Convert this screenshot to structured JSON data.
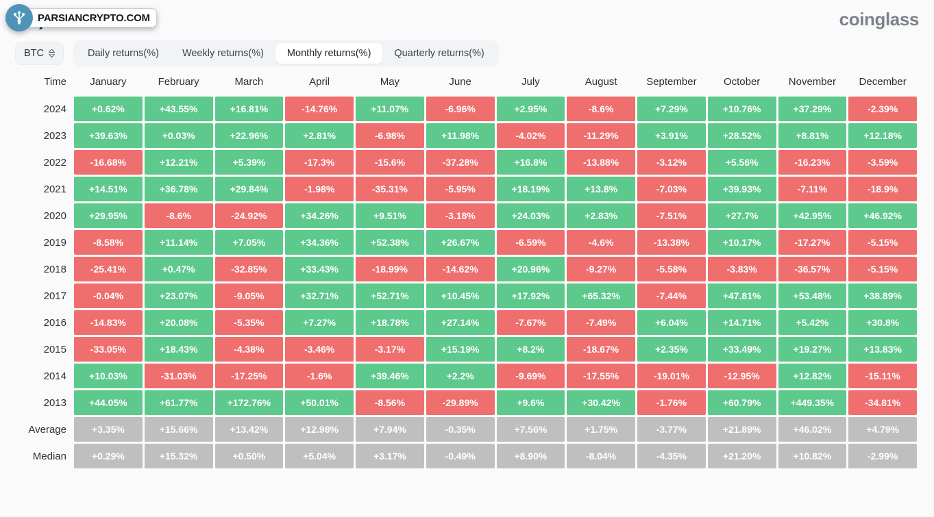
{
  "header": {
    "title": "(%)",
    "brand": "coinglass"
  },
  "watermark": {
    "text": "PARSIANCRYPTO.COM",
    "badge_icon": "tree-icon",
    "badge_color": "#4f93b8"
  },
  "controls": {
    "symbol": "BTC",
    "stepper_icon": "chevron-up-down-icon",
    "tabs": [
      {
        "label": "Daily returns(%)",
        "active": false
      },
      {
        "label": "Weekly returns(%)",
        "active": false
      },
      {
        "label": "Monthly returns(%)",
        "active": true
      },
      {
        "label": "Quarterly returns(%)",
        "active": false
      }
    ]
  },
  "colors": {
    "positive": "#5dc98c",
    "negative": "#ef6e6e",
    "neutral": "#bfbfbf",
    "page_bg": "#fafafa"
  },
  "chart_data": {
    "type": "heatmap",
    "title": "(%)",
    "xlabel": "",
    "ylabel": "Time",
    "columns": [
      "Time",
      "January",
      "February",
      "March",
      "April",
      "May",
      "June",
      "July",
      "August",
      "September",
      "October",
      "November",
      "December"
    ],
    "categories": [
      "January",
      "February",
      "March",
      "April",
      "May",
      "June",
      "July",
      "August",
      "September",
      "October",
      "November",
      "December"
    ],
    "rows": [
      {
        "label": "2024",
        "kind": "year",
        "values": [
          "+0.62%",
          "+43.55%",
          "+16.81%",
          "-14.76%",
          "+11.07%",
          "-6.96%",
          "+2.95%",
          "-8.6%",
          "+7.29%",
          "+10.76%",
          "+37.29%",
          "-2.39%"
        ]
      },
      {
        "label": "2023",
        "kind": "year",
        "values": [
          "+39.63%",
          "+0.03%",
          "+22.96%",
          "+2.81%",
          "-6.98%",
          "+11.98%",
          "-4.02%",
          "-11.29%",
          "+3.91%",
          "+28.52%",
          "+8.81%",
          "+12.18%"
        ]
      },
      {
        "label": "2022",
        "kind": "year",
        "values": [
          "-16.68%",
          "+12.21%",
          "+5.39%",
          "-17.3%",
          "-15.6%",
          "-37.28%",
          "+16.8%",
          "-13.88%",
          "-3.12%",
          "+5.56%",
          "-16.23%",
          "-3.59%"
        ]
      },
      {
        "label": "2021",
        "kind": "year",
        "values": [
          "+14.51%",
          "+36.78%",
          "+29.84%",
          "-1.98%",
          "-35.31%",
          "-5.95%",
          "+18.19%",
          "+13.8%",
          "-7.03%",
          "+39.93%",
          "-7.11%",
          "-18.9%"
        ]
      },
      {
        "label": "2020",
        "kind": "year",
        "values": [
          "+29.95%",
          "-8.6%",
          "-24.92%",
          "+34.26%",
          "+9.51%",
          "-3.18%",
          "+24.03%",
          "+2.83%",
          "-7.51%",
          "+27.7%",
          "+42.95%",
          "+46.92%"
        ]
      },
      {
        "label": "2019",
        "kind": "year",
        "values": [
          "-8.58%",
          "+11.14%",
          "+7.05%",
          "+34.36%",
          "+52.38%",
          "+26.67%",
          "-6.59%",
          "-4.6%",
          "-13.38%",
          "+10.17%",
          "-17.27%",
          "-5.15%"
        ]
      },
      {
        "label": "2018",
        "kind": "year",
        "values": [
          "-25.41%",
          "+0.47%",
          "-32.85%",
          "+33.43%",
          "-18.99%",
          "-14.62%",
          "+20.96%",
          "-9.27%",
          "-5.58%",
          "-3.83%",
          "-36.57%",
          "-5.15%"
        ]
      },
      {
        "label": "2017",
        "kind": "year",
        "values": [
          "-0.04%",
          "+23.07%",
          "-9.05%",
          "+32.71%",
          "+52.71%",
          "+10.45%",
          "+17.92%",
          "+65.32%",
          "-7.44%",
          "+47.81%",
          "+53.48%",
          "+38.89%"
        ]
      },
      {
        "label": "2016",
        "kind": "year",
        "values": [
          "-14.83%",
          "+20.08%",
          "-5.35%",
          "+7.27%",
          "+18.78%",
          "+27.14%",
          "-7.67%",
          "-7.49%",
          "+6.04%",
          "+14.71%",
          "+5.42%",
          "+30.8%"
        ]
      },
      {
        "label": "2015",
        "kind": "year",
        "values": [
          "-33.05%",
          "+18.43%",
          "-4.38%",
          "-3.46%",
          "-3.17%",
          "+15.19%",
          "+8.2%",
          "-18.67%",
          "+2.35%",
          "+33.49%",
          "+19.27%",
          "+13.83%"
        ]
      },
      {
        "label": "2014",
        "kind": "year",
        "values": [
          "+10.03%",
          "-31.03%",
          "-17.25%",
          "-1.6%",
          "+39.46%",
          "+2.2%",
          "-9.69%",
          "-17.55%",
          "-19.01%",
          "-12.95%",
          "+12.82%",
          "-15.11%"
        ]
      },
      {
        "label": "2013",
        "kind": "year",
        "values": [
          "+44.05%",
          "+61.77%",
          "+172.76%",
          "+50.01%",
          "-8.56%",
          "-29.89%",
          "+9.6%",
          "+30.42%",
          "-1.76%",
          "+60.79%",
          "+449.35%",
          "-34.81%"
        ]
      },
      {
        "label": "Average",
        "kind": "summary",
        "values": [
          "+3.35%",
          "+15.66%",
          "+13.42%",
          "+12.98%",
          "+7.94%",
          "-0.35%",
          "+7.56%",
          "+1.75%",
          "-3.77%",
          "+21.89%",
          "+46.02%",
          "+4.79%"
        ]
      },
      {
        "label": "Median",
        "kind": "summary",
        "values": [
          "+0.29%",
          "+15.32%",
          "+0.50%",
          "+5.04%",
          "+3.17%",
          "-0.49%",
          "+8.90%",
          "-8.04%",
          "-4.35%",
          "+21.20%",
          "+10.82%",
          "-2.99%"
        ]
      }
    ]
  }
}
